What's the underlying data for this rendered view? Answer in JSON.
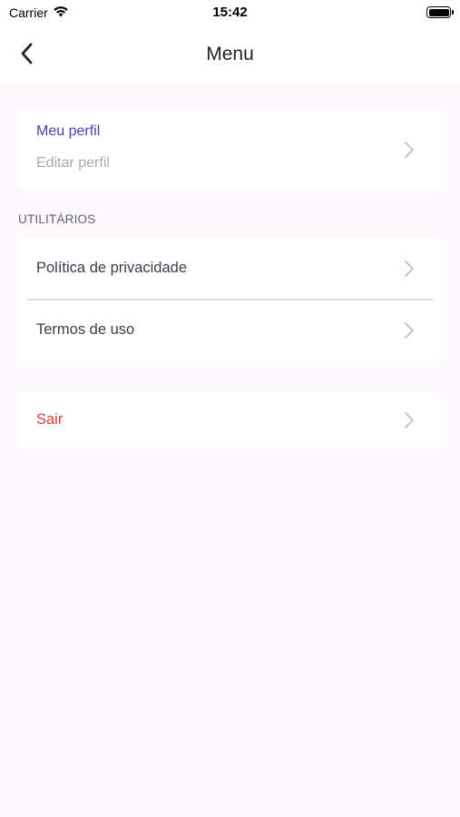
{
  "status_bar": {
    "carrier": "Carrier",
    "time": "15:42",
    "icons": [
      "wifi-icon",
      "battery-icon"
    ]
  },
  "nav": {
    "title": "Menu",
    "back_icon": "chevron-left-icon"
  },
  "profile": {
    "title": "Meu perfil",
    "subtitle": "Editar perfil"
  },
  "utilities": {
    "header": "UTILITÁRIOS",
    "items": [
      {
        "label": "Política de privacidade"
      },
      {
        "label": "Termos de uso"
      }
    ]
  },
  "logout": {
    "label": "Sair"
  },
  "colors": {
    "accent": "#5438b8",
    "danger": "#e03e3a",
    "background": "#fdf8fc",
    "muted": "#a9a9ae"
  }
}
